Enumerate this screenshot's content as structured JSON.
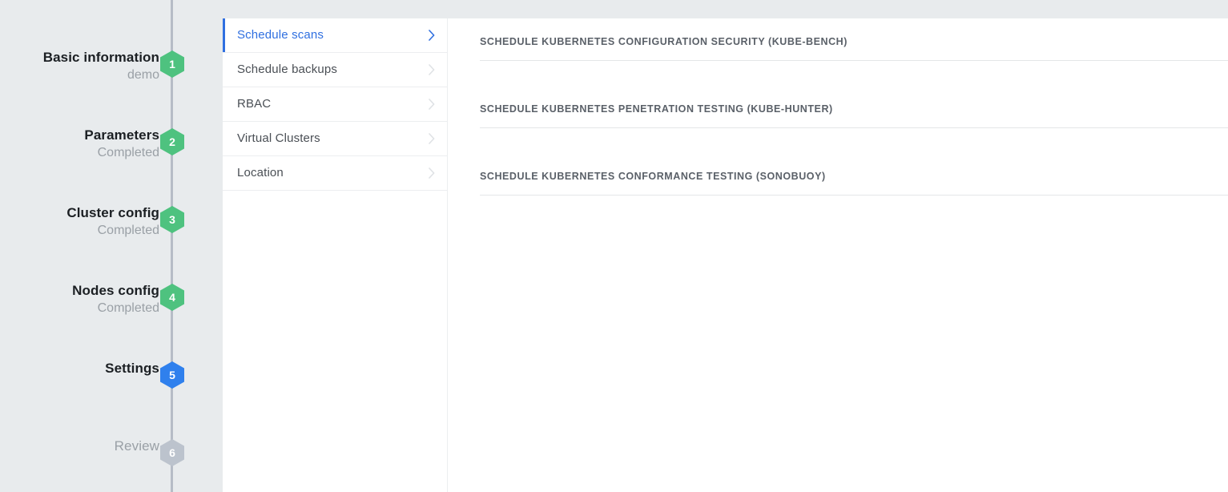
{
  "window": {
    "background_color": "#e8ebed",
    "panel_color": "#ffffff"
  },
  "colors": {
    "accent_blue": "#2f6fe0",
    "step_complete_green": "#4ec27f",
    "step_current_blue": "#2f80ed",
    "step_pending_gray": "#bcc3cd",
    "rail_gray": "#b6bcc6",
    "divider_gray": "#eceef0",
    "text_dark": "#1b1f23",
    "text_muted": "#9aa0a6",
    "header_text": "#5a6068"
  },
  "stepper": {
    "steps": [
      {
        "number": "1",
        "title": "Basic information",
        "subtitle": "demo",
        "state": "completed"
      },
      {
        "number": "2",
        "title": "Parameters",
        "subtitle": "Completed",
        "state": "completed"
      },
      {
        "number": "3",
        "title": "Cluster config",
        "subtitle": "Completed",
        "state": "completed"
      },
      {
        "number": "4",
        "title": "Nodes config",
        "subtitle": "Completed",
        "state": "completed"
      },
      {
        "number": "5",
        "title": "Settings",
        "subtitle": "",
        "state": "current"
      },
      {
        "number": "6",
        "title": "Review",
        "subtitle": "",
        "state": "pending"
      }
    ]
  },
  "nav": {
    "items": [
      {
        "label": "Schedule scans",
        "active": true,
        "icon": "chevron-right-icon"
      },
      {
        "label": "Schedule backups",
        "active": false,
        "icon": "chevron-right-icon"
      },
      {
        "label": "RBAC",
        "active": false,
        "icon": "chevron-right-icon"
      },
      {
        "label": "Virtual Clusters",
        "active": false,
        "icon": "chevron-right-icon"
      },
      {
        "label": "Location",
        "active": false,
        "icon": "chevron-right-icon"
      }
    ]
  },
  "content": {
    "sections": [
      {
        "header": "SCHEDULE KUBERNETES CONFIGURATION SECURITY (KUBE-BENCH)"
      },
      {
        "header": "SCHEDULE KUBERNETES PENETRATION TESTING (KUBE-HUNTER)"
      },
      {
        "header": "SCHEDULE KUBERNETES CONFORMANCE TESTING (SONOBUOY)"
      }
    ]
  }
}
